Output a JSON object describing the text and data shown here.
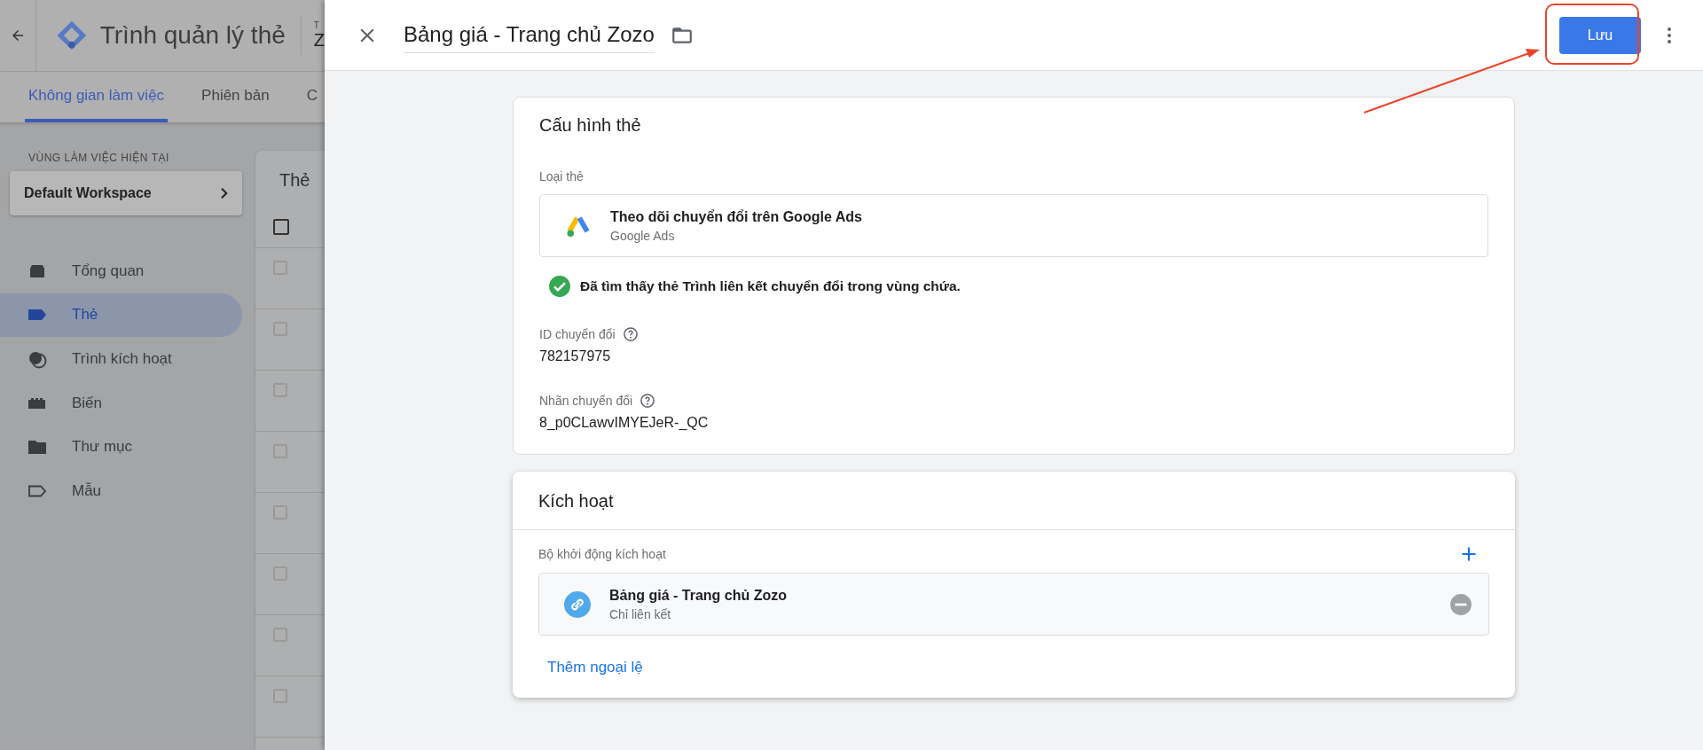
{
  "background_app": {
    "title": "Trình quản lý thẻ",
    "container_caption": "T",
    "container_name": "Z",
    "tabs": [
      {
        "label": "Không gian làm việc",
        "selected": true
      },
      {
        "label": "Phiên bản",
        "selected": false
      },
      {
        "label": "C",
        "selected": false
      }
    ],
    "workspace": {
      "caption": "VÙNG LÀM VIỆC HIỆN TẠI",
      "name": "Default Workspace"
    },
    "nav": [
      {
        "label": "Tổng quan",
        "selected": false
      },
      {
        "label": "Thẻ",
        "selected": true
      },
      {
        "label": "Trình kích hoạt",
        "selected": false
      },
      {
        "label": "Biến",
        "selected": false
      },
      {
        "label": "Thư mục",
        "selected": false
      },
      {
        "label": "Mẫu",
        "selected": false
      }
    ],
    "table": {
      "title": "Thẻ",
      "header_checked": false,
      "rows": [
        {
          "checked": false
        },
        {
          "checked": false
        },
        {
          "checked": false
        },
        {
          "checked": false
        },
        {
          "checked": false
        },
        {
          "checked": false
        },
        {
          "checked": false
        },
        {
          "checked": false
        }
      ]
    }
  },
  "panel": {
    "title": "Bảng giá - Trang chủ Zozo",
    "save_label": "Lưu",
    "config": {
      "heading": "Cấu hình thẻ",
      "type_label": "Loại thẻ",
      "type_name": "Theo dõi chuyển đổi trên Google Ads",
      "type_sub": "Google Ads",
      "notice": "Đã tìm thấy thẻ Trình liên kết chuyển đổi trong vùng chứa.",
      "fields": [
        {
          "label": "ID chuyển đổi",
          "value": "782157975"
        },
        {
          "label": "Nhãn chuyển đổi",
          "value": "8_p0CLawvIMYEJeR-_QC"
        }
      ]
    },
    "triggering": {
      "heading": "Kích hoạt",
      "section_label": "Bộ khởi động kích hoạt",
      "triggers": [
        {
          "name": "Bảng giá - Trang chủ Zozo",
          "type": "Chỉ liên kết"
        }
      ],
      "add_exception": "Thêm ngoại lệ"
    }
  }
}
